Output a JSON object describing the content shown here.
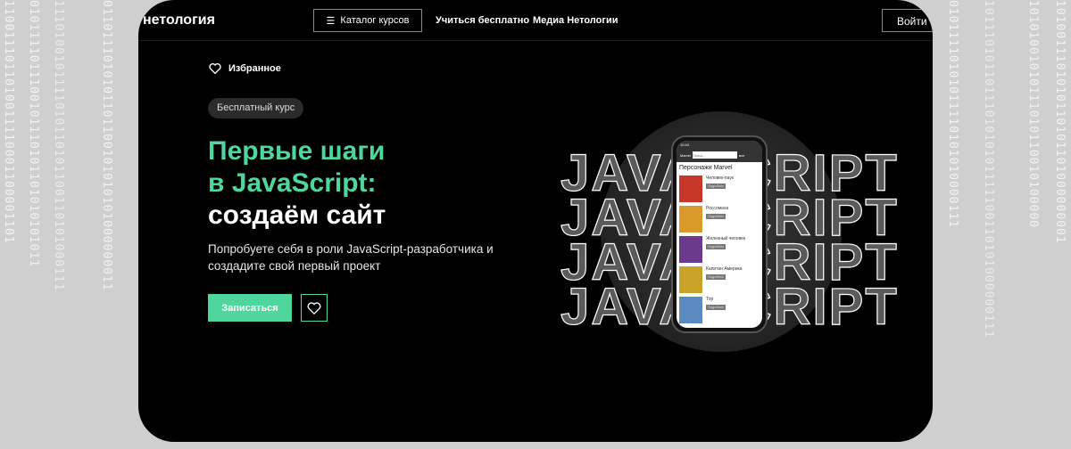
{
  "header": {
    "logo": "нетология",
    "catalog": "Каталог курсов",
    "nav": [
      "Учиться бесплатно",
      "Медиа Нетологии"
    ],
    "login": "Войти"
  },
  "hero": {
    "favorites": "Избранное",
    "badge": "Бесплатный курс",
    "title_green": [
      "Первые шаги",
      "в JavaScript:"
    ],
    "title_white": "создаём сайт",
    "subtitle": "Попробуете себя в роли JavaScript-разработчика и создадите свой первый проект",
    "enroll": "Записаться"
  },
  "art": {
    "word": "JAVASCRIPT",
    "phone": {
      "time": "10:43",
      "brand": "Marvel",
      "search_placeholder": "Поиск...",
      "all": "все",
      "heading": "Персонажи Marvel",
      "more": "Подробнее",
      "items": [
        {
          "name": "Человек-паук",
          "color": "#c8382a"
        },
        {
          "name": "Россомаха",
          "color": "#d79a2a"
        },
        {
          "name": "Железный человек",
          "color": "#6b3a8a"
        },
        {
          "name": "Капитан Америка",
          "color": "#c9a22a"
        },
        {
          "name": "Тор",
          "color": "#5a8ac0"
        }
      ]
    }
  },
  "binary": [
    "1100111011010011110001100001101",
    "0101111011100101110101101010101011",
    "1110100101111010110101100110101000111",
    "0110111010101101100101010101000000011",
    "01011110101011110101010000111",
    "1011101011011101010101111100110101000000111",
    "10101001010111010110010100000",
    "1010011101010110101101000000001"
  ]
}
